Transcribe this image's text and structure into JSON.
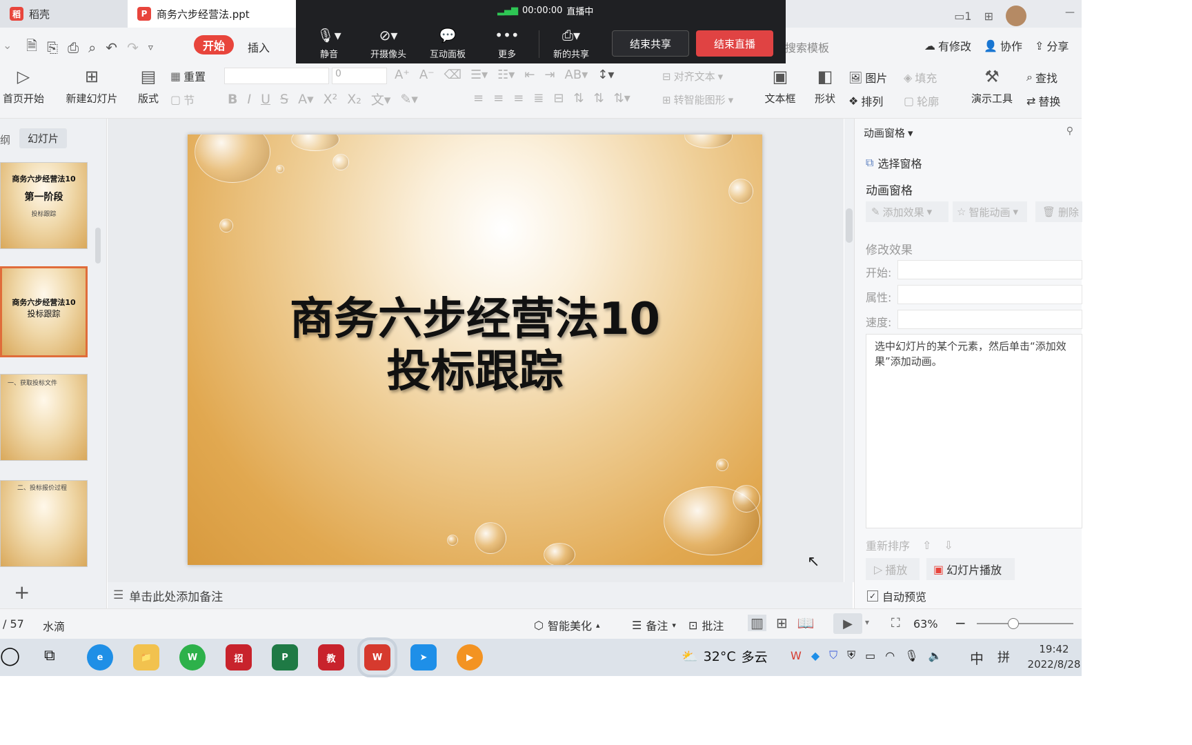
{
  "titlebar": {
    "tabs": [
      {
        "label": "稻壳",
        "icon": "docer-logo-icon"
      },
      {
        "label": "商务六步经营法.ppt",
        "icon": "ppt-file-icon"
      }
    ]
  },
  "live": {
    "timer": "00:00:00",
    "status": "直播中",
    "buttons": [
      "静音",
      "开摄像头",
      "互动面板",
      "更多",
      "新的共享"
    ],
    "end_share": "结束共享",
    "end_live": "结束直播"
  },
  "ribbon_tabs": {
    "active": "开始",
    "insert": "插入",
    "search": "搜索模板",
    "has_changes": "有修改",
    "collab": "协作",
    "share": "分享"
  },
  "ribbon": {
    "from_start": "首页开始",
    "new_slide": "新建幻灯片",
    "layout": "版式",
    "reset": "重置",
    "section": "节",
    "font_size": "0",
    "align_text": "对齐文本",
    "smart_art": "转智能图形",
    "textbox": "文本框",
    "shape": "形状",
    "picture": "图片",
    "fill": "填充",
    "arrange": "排列",
    "outline": "轮廓",
    "present_tools": "演示工具",
    "find": "查找",
    "replace": "替换"
  },
  "left_panel": {
    "tab_outline": "纲",
    "tab_slides": "幻灯片",
    "thumbs": [
      {
        "title": "商务六步经营法10",
        "sub": "第一阶段",
        "note": "投标跟踪"
      },
      {
        "title": "商务六步经营法10",
        "sub": "投标跟踪",
        "note": ""
      },
      {
        "title": "一、获取投标文件",
        "sub": "",
        "note": ""
      },
      {
        "title": "二、投标报价过程",
        "sub": "",
        "note": ""
      }
    ],
    "add": "+"
  },
  "slide": {
    "line1": "商务六步经营法10",
    "line2": "投标跟踪"
  },
  "notes": {
    "placeholder": "单击此处添加备注"
  },
  "right_panel": {
    "header": "动画窗格",
    "select_pane": "选择窗格",
    "anim_pane": "动画窗格",
    "add_effect": "添加效果",
    "smart_anim": "智能动画",
    "delete": "删除",
    "modify": "修改效果",
    "start": "开始:",
    "property": "属性:",
    "speed": "速度:",
    "hint": "选中幻灯片的某个元素，然后单击“添加效果”添加动画。",
    "reorder": "重新排序",
    "play": "播放",
    "slideshow": "幻灯片播放",
    "auto_preview": "自动预览"
  },
  "status": {
    "page": "/ 57",
    "theme": "水滴",
    "beautify": "智能美化",
    "notes": "备注",
    "comment": "批注",
    "zoom": "63%"
  },
  "taskbar": {
    "weather": "32°C",
    "weather_desc": "多云",
    "ime": "中",
    "ime2": "拼",
    "time": "19:42",
    "date": "2022/8/28"
  },
  "colors": {
    "accent": "#e8453c",
    "live_bg": "#1f2023",
    "end_live": "#e04343"
  }
}
